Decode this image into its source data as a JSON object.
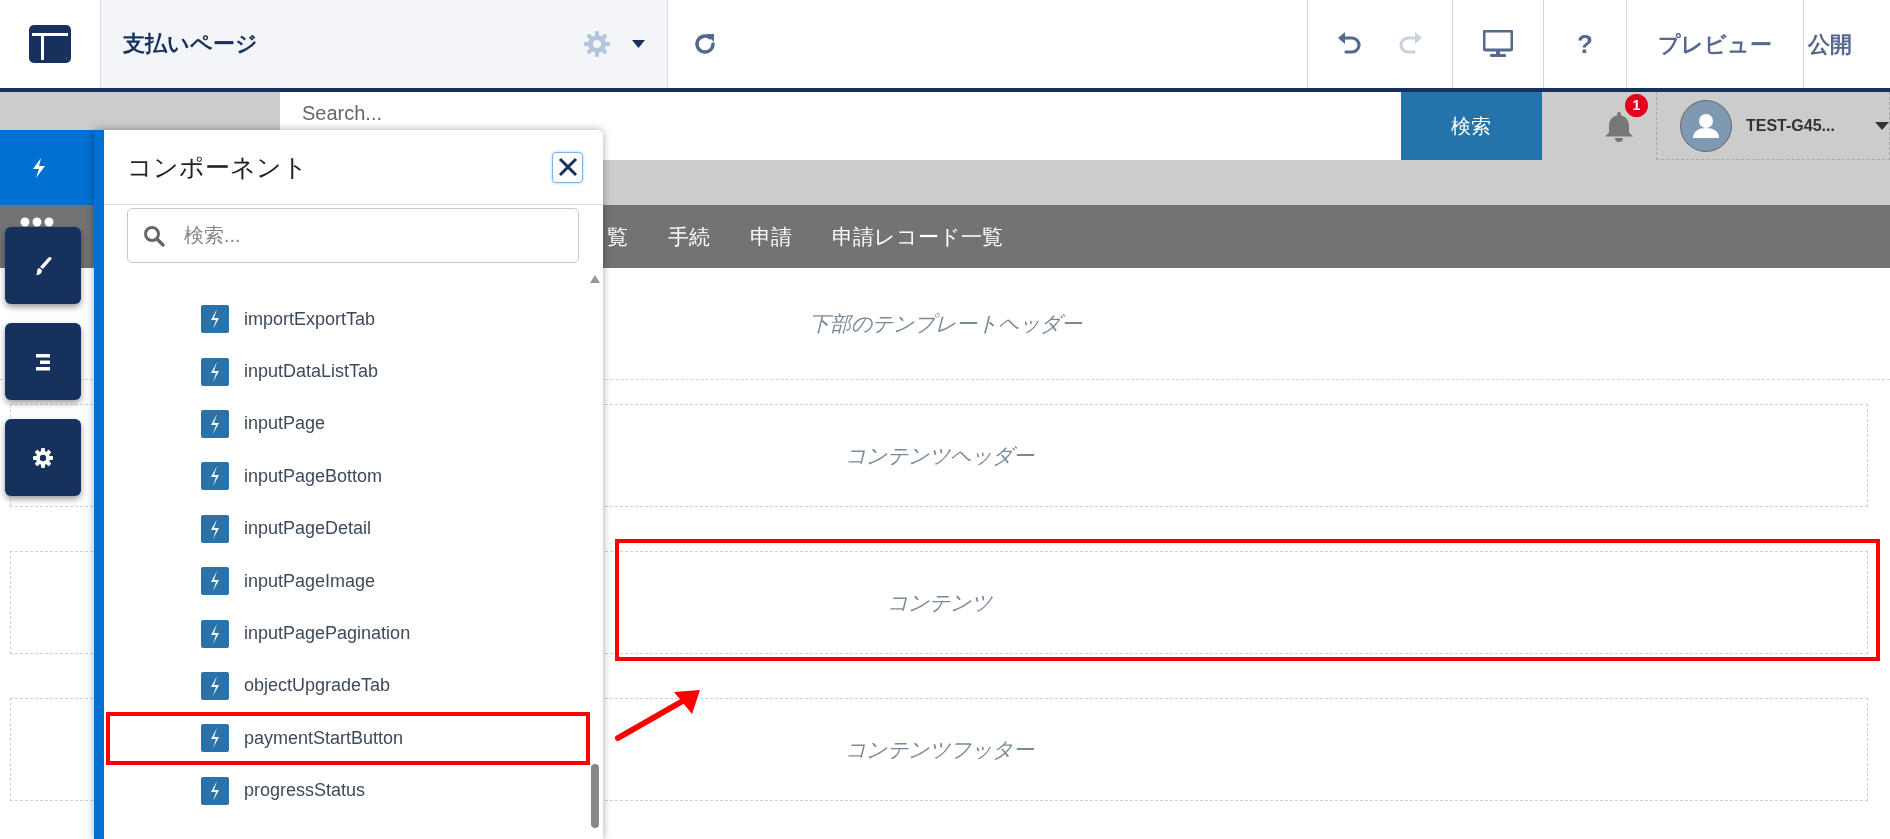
{
  "toolbar": {
    "title": "支払いページ",
    "history": [
      {
        "kind": "undo",
        "disabled": false
      },
      {
        "kind": "redo",
        "disabled": true
      }
    ],
    "help_label": "?",
    "preview_label": "プレビュー",
    "publish_label": "公開"
  },
  "site_header": {
    "search_placeholder": "Search...",
    "search_button": "検索",
    "notification_count": "1",
    "user_name": "TEST-G45..."
  },
  "nav": {
    "items": [
      "覧",
      "手続",
      "申請",
      "申請レコード一覧"
    ]
  },
  "sections": [
    {
      "label": "下部のテンプレートヘッダー",
      "kind": "band",
      "highlighted": false
    },
    {
      "label": "コンテンツヘッダー",
      "kind": "box",
      "highlighted": false
    },
    {
      "label": "コンテンツ",
      "kind": "box",
      "highlighted": true
    },
    {
      "label": "コンテンツフッター",
      "kind": "box",
      "highlighted": false
    }
  ],
  "rail": [
    {
      "kind": "components",
      "selected": true
    },
    {
      "kind": "theme",
      "selected": false
    },
    {
      "kind": "structure",
      "selected": false
    },
    {
      "kind": "settings",
      "selected": false
    }
  ],
  "panel": {
    "title": "コンポーネント",
    "search_placeholder": "検索...",
    "items": [
      {
        "label": "importExportTab",
        "highlighted": false
      },
      {
        "label": "inputDataListTab",
        "highlighted": false
      },
      {
        "label": "inputPage",
        "highlighted": false
      },
      {
        "label": "inputPageBottom",
        "highlighted": false
      },
      {
        "label": "inputPageDetail",
        "highlighted": false
      },
      {
        "label": "inputPageImage",
        "highlighted": false
      },
      {
        "label": "inputPagePagination",
        "highlighted": false
      },
      {
        "label": "objectUpgradeTab",
        "highlighted": false
      },
      {
        "label": "paymentStartButton",
        "highlighted": true
      },
      {
        "label": "progressStatus",
        "highlighted": false
      }
    ]
  },
  "annotation_arrow": true
}
